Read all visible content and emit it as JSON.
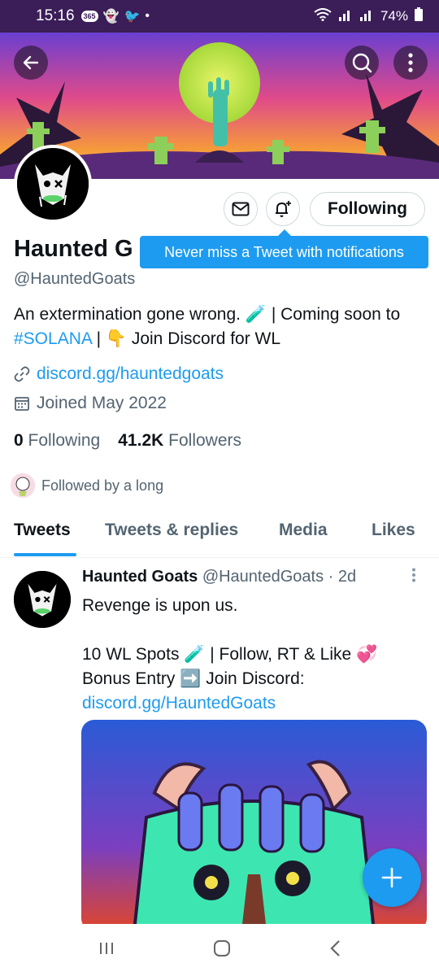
{
  "status_bar": {
    "time": "15:16",
    "badge": "365",
    "battery": "74%"
  },
  "profile": {
    "display_name": "Haunted G",
    "handle": "@HauntedGoats",
    "bio_part1": "An extermination gone wrong. 🧪 | Coming soon to ",
    "bio_hashtag": "#SOLANA",
    "bio_part2": " | 👇 Join Discord for WL",
    "url": "discord.gg/hauntedgoats",
    "joined": "Joined May 2022",
    "following_count": "0",
    "following_label": "Following",
    "followers_count": "41.2K",
    "followers_label": "Followers",
    "followed_by": "Followed by a long"
  },
  "actions": {
    "following_button": "Following"
  },
  "tooltip": "Never miss a Tweet with notifications",
  "tabs": [
    {
      "label": "Tweets",
      "active": true
    },
    {
      "label": "Tweets & replies",
      "active": false
    },
    {
      "label": "Media",
      "active": false
    },
    {
      "label": "Likes",
      "active": false
    }
  ],
  "tweet": {
    "author": "Haunted Goats",
    "handle": "@HauntedGoats",
    "time": "· 2d",
    "line1": "Revenge is upon us.",
    "line2": "10 WL Spots 🧪 | Follow, RT & Like 💞",
    "line3": "Bonus Entry ➡️ Join Discord:",
    "link": "discord.gg/HauntedGoats"
  },
  "icons": {
    "back": "arrow-left-icon",
    "search": "search-icon",
    "more": "more-vertical-icon",
    "message": "envelope-icon",
    "notify": "bell-plus-icon",
    "link": "link-icon",
    "calendar": "calendar-icon",
    "compose": "plus-icon"
  },
  "colors": {
    "accent": "#1d9bf0",
    "status_bar": "#3b1d58",
    "text_secondary": "#536471"
  }
}
